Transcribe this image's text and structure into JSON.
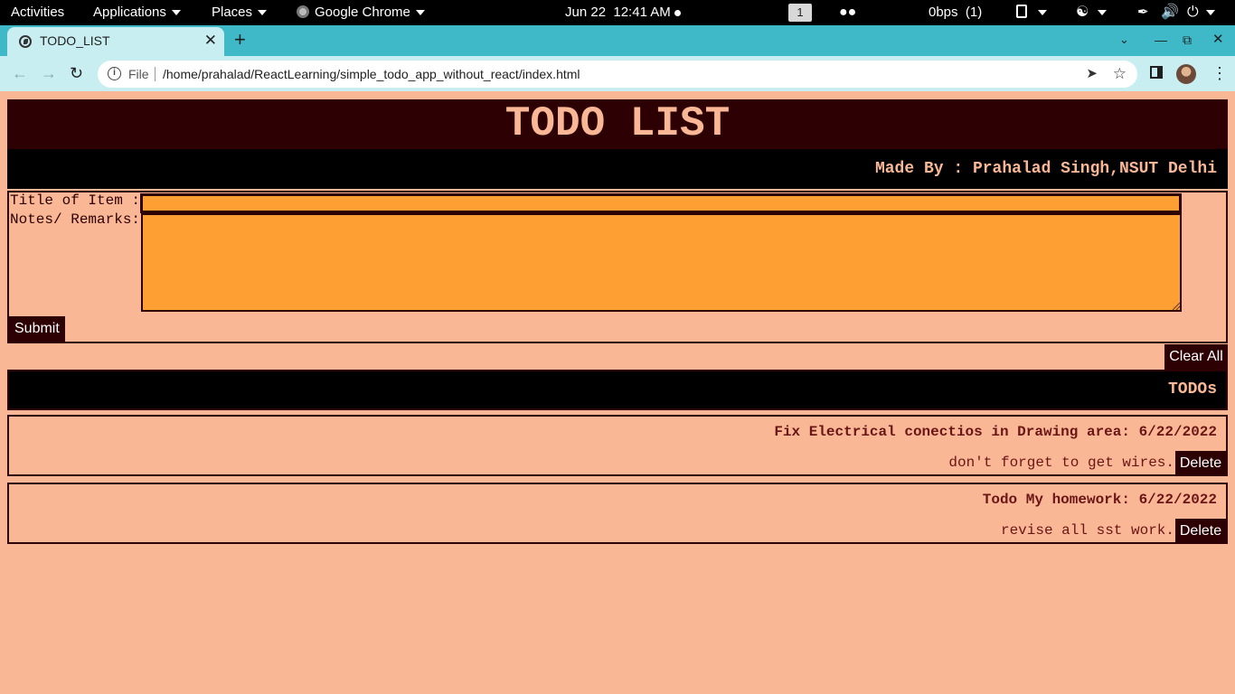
{
  "system_bar": {
    "activities": "Activities",
    "applications": "Applications",
    "places": "Places",
    "active_app": "Google Chrome",
    "clock": "Jun 22  12:41 AM",
    "workspace": "1",
    "network_speed": "0bps",
    "network_count": "(1)"
  },
  "browser": {
    "tab_title": "TODO_LIST",
    "url_scheme_label": "File",
    "url": "/home/prahalad/ReactLearning/simple_todo_app_without_react/index.html",
    "accent_color": "#3fb9c7"
  },
  "page": {
    "heading": "TODO LIST",
    "made_by": "Made By : Prahalad Singh,NSUT Delhi",
    "form": {
      "title_label": "Title of Item :",
      "title_value": "",
      "notes_label": "Notes/ Remarks:",
      "notes_value": "",
      "submit_label": "Submit"
    },
    "clear_all_label": "Clear All",
    "todos_heading": "TODOs",
    "todos": [
      {
        "title": "Fix Electrical conectios in Drawing area: 6/22/2022",
        "note": "don't forget to get wires.",
        "delete_label": "Delete"
      },
      {
        "title": "Todo My homework: 6/22/2022",
        "note": "revise all sst work.",
        "delete_label": "Delete"
      }
    ],
    "colors": {
      "background": "#fab796",
      "dark": "#2d0003",
      "input": "#fe9f33"
    }
  }
}
